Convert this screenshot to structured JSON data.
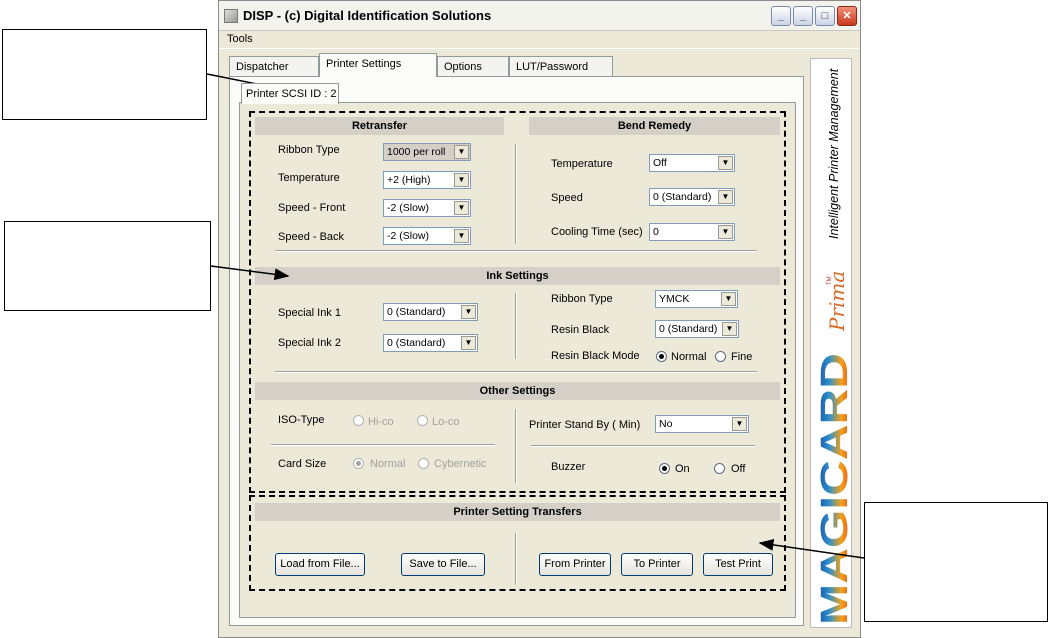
{
  "window": {
    "title": "DISP - (c) Digital Identification Solutions"
  },
  "menu": {
    "tools": "Tools"
  },
  "tabs": [
    "Dispatcher",
    "Printer Settings",
    "Options",
    "LUT/Password"
  ],
  "subtab": "Printer SCSI ID : 2",
  "retransfer": {
    "header": "Retransfer",
    "ribbon_type_label": "Ribbon Type",
    "ribbon_type_value": "1000 per roll",
    "temperature_label": "Temperature",
    "temperature_value": "+2 (High)",
    "speed_front_label": "Speed - Front",
    "speed_front_value": "-2 (Slow)",
    "speed_back_label": "Speed - Back",
    "speed_back_value": "-2 (Slow)"
  },
  "bend_remedy": {
    "header": "Bend Remedy",
    "temperature_label": "Temperature",
    "temperature_value": "Off",
    "speed_label": "Speed",
    "speed_value": "0 (Standard)",
    "cooling_label": "Cooling Time (sec)",
    "cooling_value": "0"
  },
  "ink": {
    "header": "Ink Settings",
    "special1_label": "Special Ink 1",
    "special1_value": "0 (Standard)",
    "special2_label": "Special Ink 2",
    "special2_value": "0 (Standard)",
    "ribbon_type_label": "Ribbon Type",
    "ribbon_type_value": "YMCK",
    "resin_black_label": "Resin Black",
    "resin_black_value": "0 (Standard)",
    "resin_mode_label": "Resin Black Mode",
    "mode_normal": "Normal",
    "mode_fine": "Fine"
  },
  "other": {
    "header": "Other Settings",
    "iso_label": "ISO-Type",
    "hico": "Hi-co",
    "loco": "Lo-co",
    "card_size_label": "Card Size",
    "normal": "Normal",
    "cybernetic": "Cybernetic",
    "standby_label": "Printer Stand By ( Min)",
    "standby_value": "No",
    "buzzer_label": "Buzzer",
    "on": "On",
    "off": "Off"
  },
  "transfers": {
    "header": "Printer Setting Transfers",
    "load": "Load from File...",
    "save": "Save to File...",
    "from_printer": "From Printer",
    "to_printer": "To Printer",
    "test_print": "Test Print"
  },
  "brand": {
    "tagline": "Intelligent Printer Management",
    "prima": "Prima",
    "tm": "TM",
    "logo": "MAGICARD"
  }
}
